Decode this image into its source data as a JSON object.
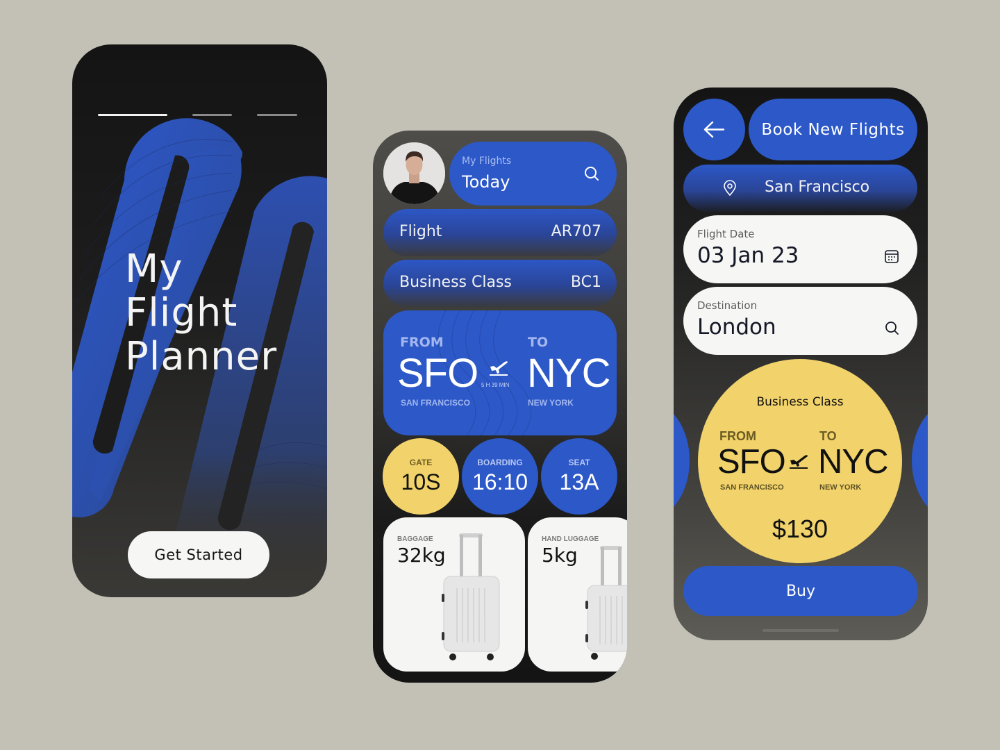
{
  "colors": {
    "background": "#c3c1b6",
    "brand_blue": "#2c58c8",
    "accent_yellow": "#f2d36b",
    "dark": "#141414",
    "card_white": "#f6f6f4"
  },
  "onboarding": {
    "progress_steps": 3,
    "active_step": 1,
    "title_lines": [
      "My",
      "Flight",
      "Planner"
    ],
    "cta_label": "Get Started"
  },
  "my_flights": {
    "header": {
      "subtitle": "My Flights",
      "title": "Today",
      "search_icon": "search-icon",
      "avatar_icon": "user-avatar"
    },
    "flight": {
      "label": "Flight",
      "value": "AR707"
    },
    "class": {
      "label": "Business Class",
      "value": "BC1"
    },
    "route": {
      "from_label": "FROM",
      "from_code": "SFO",
      "from_city": "SAN FRANCISCO",
      "to_label": "TO",
      "to_code": "NYC",
      "to_city": "NEW YORK",
      "duration": "5 H 39 MIN",
      "plane_icon": "plane-takeoff-icon"
    },
    "stats": [
      {
        "label": "GATE",
        "value": "10S"
      },
      {
        "label": "BOARDING",
        "value": "16:10"
      },
      {
        "label": "SEAT",
        "value": "13A"
      }
    ],
    "baggage": [
      {
        "label": "BAGGAGE",
        "value": "32kg"
      },
      {
        "label": "HAND LUGGAGE",
        "value": "5kg"
      }
    ]
  },
  "booking": {
    "back_icon": "arrow-left-icon",
    "title": "Book New Flights",
    "origin": {
      "icon": "location-pin-icon",
      "value": "San Francisco"
    },
    "flight_date": {
      "label": "Flight Date",
      "value": "03 Jan 23",
      "icon": "calendar-icon"
    },
    "destination": {
      "label": "Destination",
      "value": "London",
      "icon": "search-icon"
    },
    "fare": {
      "class": "Business Class",
      "from_label": "FROM",
      "from_code": "SFO",
      "from_city": "SAN FRANCISCO",
      "to_label": "TO",
      "to_code": "NYC",
      "to_city": "NEW YORK",
      "price": "$130"
    },
    "buy_label": "Buy"
  }
}
